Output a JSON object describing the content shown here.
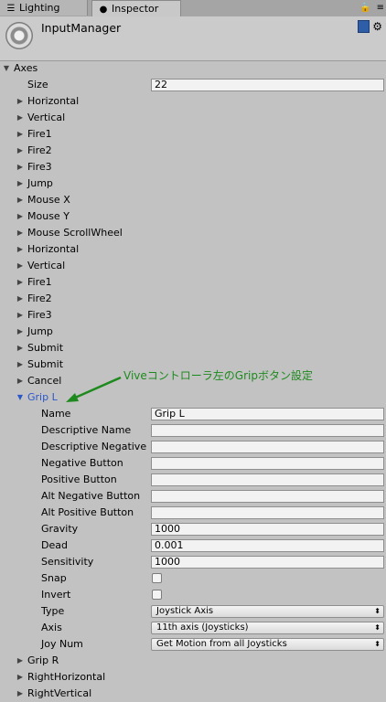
{
  "tabs": {
    "lighting": "Lighting",
    "inspector": "Inspector",
    "lock_icon": "lock-icon",
    "menu_icon": "menu-icon"
  },
  "header": {
    "title": "InputManager",
    "icon": "settings-gear-icon"
  },
  "axes": {
    "label": "Axes",
    "size_label": "Size",
    "size_value": "22",
    "items_before": [
      "Horizontal",
      "Vertical",
      "Fire1",
      "Fire2",
      "Fire3",
      "Jump",
      "Mouse X",
      "Mouse Y",
      "Mouse ScrollWheel",
      "Horizontal",
      "Vertical",
      "Fire1",
      "Fire2",
      "Fire3",
      "Jump",
      "Submit",
      "Submit",
      "Cancel"
    ],
    "expanded": {
      "label": "Grip L",
      "fields": [
        {
          "label": "Name",
          "value": "Grip L"
        },
        {
          "label": "Descriptive Name",
          "value": ""
        },
        {
          "label": "Descriptive Negative",
          "value": ""
        },
        {
          "label": "Negative Button",
          "value": ""
        },
        {
          "label": "Positive Button",
          "value": ""
        },
        {
          "label": "Alt Negative Button",
          "value": ""
        },
        {
          "label": "Alt Positive Button",
          "value": ""
        },
        {
          "label": "Gravity",
          "value": "1000"
        },
        {
          "label": "Dead",
          "value": "0.001"
        },
        {
          "label": "Sensitivity",
          "value": "1000"
        }
      ],
      "snap_label": "Snap",
      "invert_label": "Invert",
      "type_label": "Type",
      "type_value": "Joystick Axis",
      "axis_label": "Axis",
      "axis_value": "11th axis (Joysticks)",
      "joynum_label": "Joy Num",
      "joynum_value": "Get Motion from all Joysticks"
    },
    "items_after": [
      "Grip R",
      "RightHorizontal",
      "RightVertical"
    ]
  },
  "annotation": {
    "text": "Viveコントローラ左のGripボタン設定",
    "color": "#1e8a1e"
  }
}
